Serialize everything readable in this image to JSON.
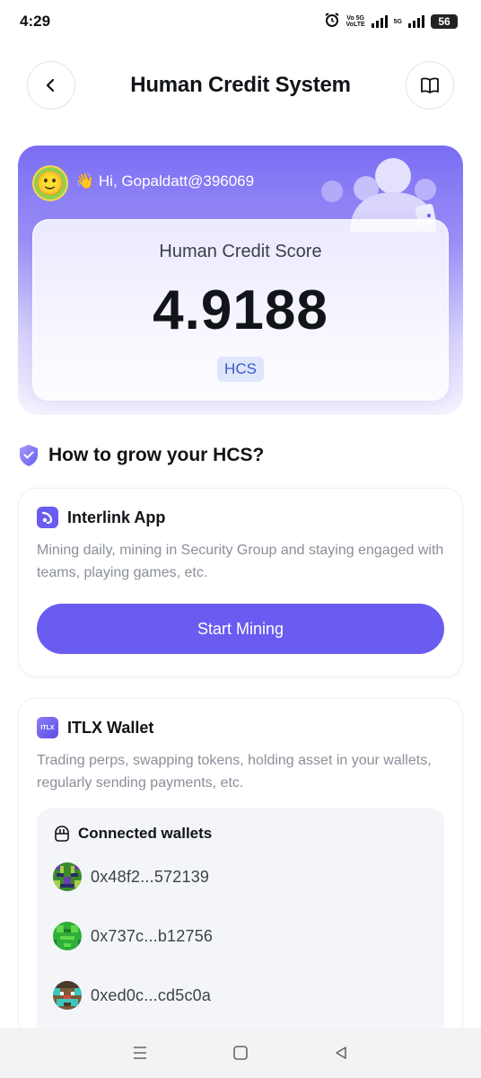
{
  "status_bar": {
    "time": "4:29",
    "net1_top": "Vo 5G",
    "net1_bottom": "VoLTE",
    "net2": "5G",
    "battery": "56"
  },
  "header": {
    "title": "Human Credit System",
    "back_icon": "chevron-left-icon",
    "guide_icon": "book-open-icon"
  },
  "hero": {
    "greeting": "👋 Hi, Gopaldatt@396069",
    "score_label": "Human Credit Score",
    "score_value": "4.9188",
    "score_unit": "HCS",
    "colors": {
      "gradient_top": "#7a6df4",
      "gradient_bottom": "#f6f5fe"
    }
  },
  "grow_section": {
    "heading": "How to grow your HCS?"
  },
  "interlink_card": {
    "title": "Interlink App",
    "description": "Mining daily, mining in Security Group and staying engaged with teams, playing games, etc.",
    "button_label": "Start Mining",
    "accent": "#6a5cf0"
  },
  "wallet_card": {
    "title": "ITLX Wallet",
    "logo_text": "ITLX",
    "description": "Trading perps, swapping tokens, holding asset in your wallets, regularly sending payments, etc.",
    "connected_title": "Connected wallets",
    "wallets": [
      {
        "address": "0x48f2...572139"
      },
      {
        "address": "0x737c...b12756"
      },
      {
        "address": "0xed0c...cd5c0a"
      }
    ]
  },
  "nav_bar": {
    "menu_icon": "menu-icon",
    "home_icon": "square-home-icon",
    "back_icon": "triangle-back-icon"
  }
}
